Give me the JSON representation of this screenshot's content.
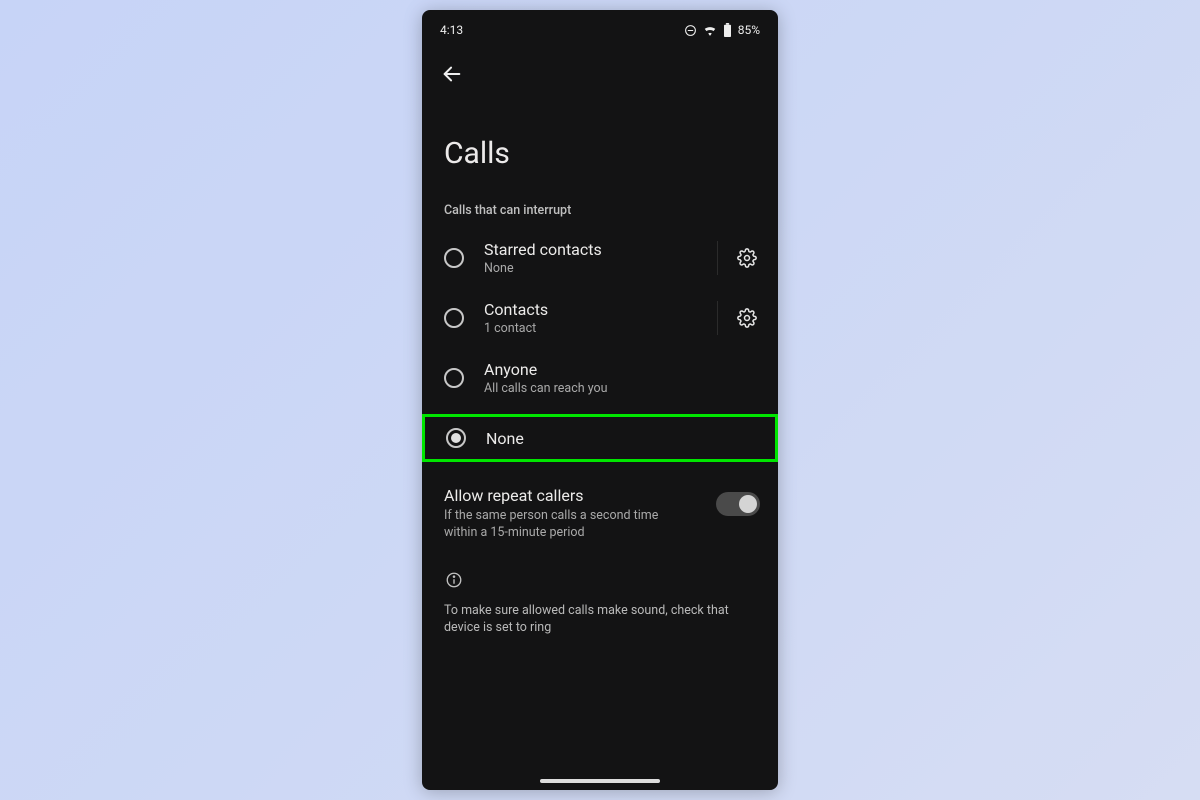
{
  "status": {
    "time": "4:13",
    "battery": "85%"
  },
  "page_title": "Calls",
  "section_label": "Calls that can interrupt",
  "options": {
    "starred": {
      "title": "Starred contacts",
      "sub": "None"
    },
    "contacts": {
      "title": "Contacts",
      "sub": "1 contact"
    },
    "anyone": {
      "title": "Anyone",
      "sub": "All calls can reach you"
    },
    "none": {
      "title": "None"
    }
  },
  "selected_option": "none",
  "highlight_option": "none",
  "repeat": {
    "title": "Allow repeat callers",
    "sub": "If the same person calls a second time within a 15-minute period",
    "enabled": true
  },
  "hint": "To make sure allowed calls make sound, check that device is set to ring",
  "colors": {
    "highlight": "#00e600",
    "background": "#131314"
  }
}
